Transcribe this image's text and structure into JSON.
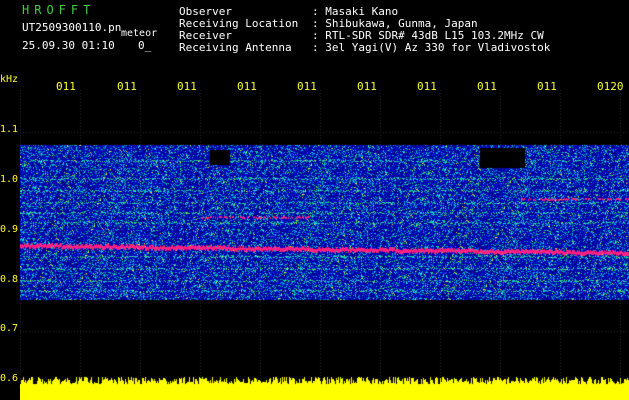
{
  "header": {
    "app_title": "HROFFT",
    "file_name": "UT2509300110.pn",
    "mode": "meteor",
    "datetime": "25.09.30 01:10",
    "sequence": "0_"
  },
  "info": [
    {
      "label": "Observer",
      "value": ": Masaki Kano"
    },
    {
      "label": "Receiving Location",
      "value": ": Shibukawa, Gunma, Japan"
    },
    {
      "label": "Receiver",
      "value": ": RTL-SDR SDR# 43dB L15 103.2MHz CW"
    },
    {
      "label": "Receiving Antenna",
      "value": ": 3el Yagi(V) Az 330 for Vladivostok"
    }
  ],
  "axis": {
    "unit": "kHz",
    "y_ticks": [
      "1.1",
      "1.0",
      "0.9",
      "0.8",
      "0.7",
      "0.6"
    ],
    "x_ticks": [
      "011",
      "011",
      "011",
      "011",
      "011",
      "011",
      "011",
      "011",
      "011",
      "0120"
    ]
  },
  "colors": {
    "label": "#ffff33",
    "title": "#44cc44",
    "background": "#000000",
    "noise": "#0000aa",
    "carrier": "#ff2080",
    "level": "#ffff00"
  }
}
